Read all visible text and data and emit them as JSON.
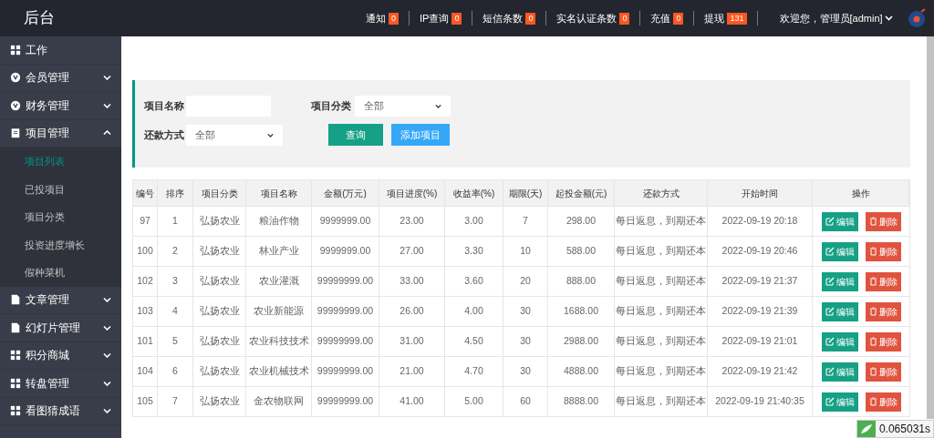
{
  "header": {
    "title": "后台",
    "nav": [
      {
        "label": "通知",
        "count": "0"
      },
      {
        "label": "IP查询",
        "count": "0"
      },
      {
        "label": "短信条数",
        "count": "0"
      },
      {
        "label": "实名认证条数",
        "count": "0"
      },
      {
        "label": "充值",
        "count": "0"
      },
      {
        "label": "提现",
        "count": "131"
      }
    ],
    "user": "欢迎您，管理员[admin]"
  },
  "sidebar": {
    "items": [
      {
        "label": "工作",
        "kind": "grid"
      },
      {
        "label": "会员管理",
        "kind": "badge",
        "expanded": false
      },
      {
        "label": "财务管理",
        "kind": "badge",
        "expanded": false
      },
      {
        "label": "项目管理",
        "kind": "clipboard",
        "expanded": true,
        "children": [
          {
            "label": "项目列表",
            "selected": true
          },
          {
            "label": "已投项目",
            "selected": false
          },
          {
            "label": "项目分类",
            "selected": false
          },
          {
            "label": "投资进度增长",
            "selected": false
          },
          {
            "label": "假种菜机",
            "selected": false
          }
        ]
      },
      {
        "label": "文章管理",
        "kind": "doc",
        "expanded": false
      },
      {
        "label": "幻灯片管理",
        "kind": "doc",
        "expanded": false
      },
      {
        "label": "积分商城",
        "kind": "grid",
        "expanded": false
      },
      {
        "label": "转盘管理",
        "kind": "grid",
        "expanded": false
      },
      {
        "label": "看图猜成语",
        "kind": "grid",
        "expanded": false
      }
    ]
  },
  "filter": {
    "name_label": "项目名称",
    "category_label": "项目分类",
    "category_value": "全部",
    "repay_label": "还款方式",
    "repay_value": "全部",
    "buttons": [
      {
        "label": "查询",
        "kind": "primary"
      },
      {
        "label": "添加项目",
        "kind": "info"
      }
    ]
  },
  "table": {
    "columns": [
      "编号",
      "排序",
      "项目分类",
      "项目名称",
      "金额(万元)",
      "项目进度(%)",
      "收益率(%)",
      "期限(天)",
      "起投金额(元)",
      "还款方式",
      "开始时间",
      "操作"
    ],
    "rows": [
      {
        "cells": [
          "97",
          "1",
          "弘扬农业",
          "粮油作物",
          "9999999.00",
          "23.00",
          "3.00",
          "7",
          "298.00",
          "每日返息，到期还本",
          "2022-09-19 20:18"
        ],
        "actions": [
          "编辑",
          "删除"
        ]
      },
      {
        "cells": [
          "100",
          "2",
          "弘扬农业",
          "林业产业",
          "9999999.00",
          "27.00",
          "3.30",
          "10",
          "588.00",
          "每日返息，到期还本",
          "2022-09-19 20:46"
        ],
        "actions": [
          "编辑",
          "删除"
        ]
      },
      {
        "cells": [
          "102",
          "3",
          "弘扬农业",
          "农业灌溉",
          "99999999.00",
          "33.00",
          "3.60",
          "20",
          "888.00",
          "每日返息，到期还本",
          "2022-09-19 21:37"
        ],
        "actions": [
          "编辑",
          "删除"
        ]
      },
      {
        "cells": [
          "103",
          "4",
          "弘扬农业",
          "农业新能源",
          "99999999.00",
          "26.00",
          "4.00",
          "30",
          "1688.00",
          "每日返息，到期还本",
          "2022-09-19 21:39"
        ],
        "actions": [
          "编辑",
          "删除"
        ]
      },
      {
        "cells": [
          "101",
          "5",
          "弘扬农业",
          "农业科技技术",
          "99999999.00",
          "31.00",
          "4.50",
          "30",
          "2988.00",
          "每日返息，到期还本",
          "2022-09-19 21:01"
        ],
        "actions": [
          "编辑",
          "删除"
        ]
      },
      {
        "cells": [
          "104",
          "6",
          "弘扬农业",
          "农业机械技术",
          "99999999.00",
          "21.00",
          "4.70",
          "30",
          "4888.00",
          "每日返息，到期还本",
          "2022-09-19 21:42"
        ],
        "actions": [
          "编辑",
          "删除"
        ]
      },
      {
        "cells": [
          "105",
          "7",
          "弘扬农业",
          "金农物联网",
          "99999999.00",
          "41.00",
          "5.00",
          "60",
          "8888.00",
          "每日返息，到期还本",
          "2022-09-19 21:40:35"
        ],
        "actions": [
          "编辑",
          "删除"
        ]
      }
    ]
  },
  "timer": "0.065031s"
}
